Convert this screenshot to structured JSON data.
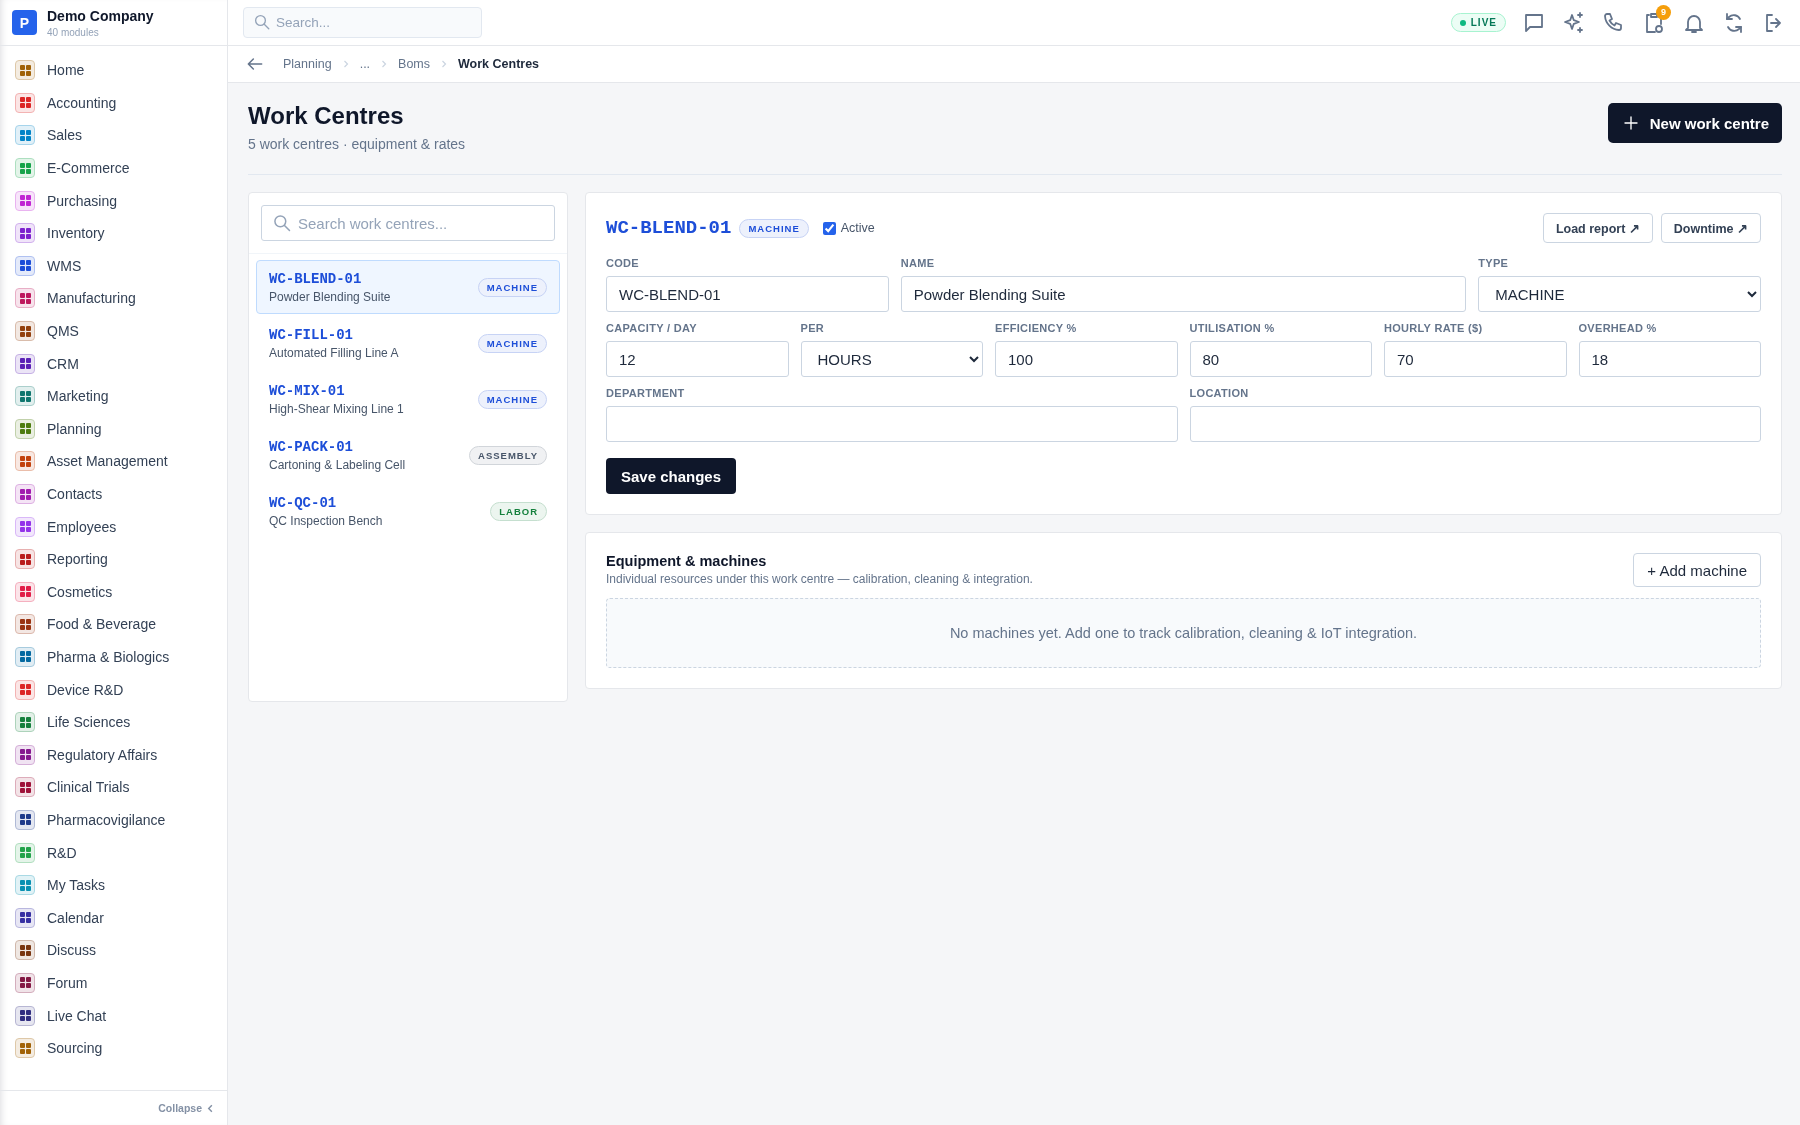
{
  "company": {
    "initial": "P",
    "name": "Demo Company",
    "subtitle": "40 modules"
  },
  "sidebar": {
    "items": [
      {
        "label": "Home",
        "color": "#a16207"
      },
      {
        "label": "Accounting",
        "color": "#dc2626"
      },
      {
        "label": "Sales",
        "color": "#0284c7"
      },
      {
        "label": "E-Commerce",
        "color": "#16a34a"
      },
      {
        "label": "Purchasing",
        "color": "#c026d3"
      },
      {
        "label": "Inventory",
        "color": "#7e22ce"
      },
      {
        "label": "WMS",
        "color": "#1d4ed8"
      },
      {
        "label": "Manufacturing",
        "color": "#be185d"
      },
      {
        "label": "QMS",
        "color": "#92400e"
      },
      {
        "label": "CRM",
        "color": "#5b21b6"
      },
      {
        "label": "Marketing",
        "color": "#0f766e"
      },
      {
        "label": "Planning",
        "color": "#4d7c0f"
      },
      {
        "label": "Asset Management",
        "color": "#c2410c"
      },
      {
        "label": "Contacts",
        "color": "#a21caf"
      },
      {
        "label": "Employees",
        "color": "#9333ea"
      },
      {
        "label": "Reporting",
        "color": "#b91c1c"
      },
      {
        "label": "Cosmetics",
        "color": "#e11d48"
      },
      {
        "label": "Food & Beverage",
        "color": "#9a3412"
      },
      {
        "label": "Pharma & Biologics",
        "color": "#0369a1"
      },
      {
        "label": "Device R&D",
        "color": "#dc2626"
      },
      {
        "label": "Life Sciences",
        "color": "#15803d"
      },
      {
        "label": "Regulatory Affairs",
        "color": "#86198f"
      },
      {
        "label": "Clinical Trials",
        "color": "#9f1239"
      },
      {
        "label": "Pharmacovigilance",
        "color": "#1e3a8a"
      },
      {
        "label": "R&D",
        "color": "#22a34a"
      },
      {
        "label": "My Tasks",
        "color": "#0891b2"
      },
      {
        "label": "Calendar",
        "color": "#3730a3"
      },
      {
        "label": "Discuss",
        "color": "#78350f"
      },
      {
        "label": "Forum",
        "color": "#831843"
      },
      {
        "label": "Live Chat",
        "color": "#312e81"
      },
      {
        "label": "Sourcing",
        "color": "#a16207"
      }
    ],
    "collapse": "Collapse"
  },
  "topbar": {
    "search_placeholder": "Search...",
    "live": "LIVE",
    "notification_count": "9"
  },
  "breadcrumbs": [
    {
      "label": "Planning",
      "current": false
    },
    {
      "label": "...",
      "current": false
    },
    {
      "label": "Boms",
      "current": false
    },
    {
      "label": "Work Centres",
      "current": true
    }
  ],
  "page": {
    "title": "Work Centres",
    "subtitle": "5 work centres · equipment & rates",
    "new_button": "New work centre"
  },
  "list": {
    "search_placeholder": "Search work centres...",
    "items": [
      {
        "code": "WC-BLEND-01",
        "name": "Powder Blending Suite",
        "type": "MACHINE",
        "color": "#1d4ed8",
        "selected": true
      },
      {
        "code": "WC-FILL-01",
        "name": "Automated Filling Line A",
        "type": "MACHINE",
        "color": "#1d4ed8",
        "selected": false
      },
      {
        "code": "WC-MIX-01",
        "name": "High-Shear Mixing Line 1",
        "type": "MACHINE",
        "color": "#1d4ed8",
        "selected": false
      },
      {
        "code": "WC-PACK-01",
        "name": "Cartoning & Labeling Cell",
        "type": "ASSEMBLY",
        "color": "#475569",
        "selected": false
      },
      {
        "code": "WC-QC-01",
        "name": "QC Inspection Bench",
        "type": "LABOR",
        "color": "#15803d",
        "selected": false
      }
    ]
  },
  "detail": {
    "code": "WC-BLEND-01",
    "type_badge": "MACHINE",
    "active": {
      "label": "Active",
      "checked": true
    },
    "actions": [
      "Load report ↗",
      "Downtime ↗"
    ],
    "rows": [
      {
        "fields": [
          {
            "label": "CODE",
            "kind": "input",
            "value": "WC-BLEND-01"
          },
          {
            "label": "NAME",
            "kind": "input",
            "value": "Powder Blending Suite"
          },
          {
            "label": "TYPE",
            "kind": "select",
            "value": "MACHINE"
          }
        ]
      },
      {
        "fields": [
          {
            "label": "CAPACITY / DAY",
            "kind": "input",
            "value": "12"
          },
          {
            "label": "PER",
            "kind": "select",
            "value": "HOURS"
          },
          {
            "label": "EFFICIENCY %",
            "kind": "input",
            "value": "100"
          },
          {
            "label": "UTILISATION %",
            "kind": "input",
            "value": "80"
          },
          {
            "label": "HOURLY RATE ($)",
            "kind": "input",
            "value": "70"
          },
          {
            "label": "OVERHEAD %",
            "kind": "input",
            "value": "18"
          }
        ]
      },
      {
        "fields": [
          {
            "label": "DEPARTMENT",
            "kind": "input"
          },
          {
            "label": "LOCATION",
            "kind": "input"
          }
        ]
      }
    ],
    "save": "Save changes"
  },
  "equipment": {
    "title": "Equipment & machines",
    "description": "Individual resources under this work centre — calibration, cleaning & integration.",
    "add_button": "+ Add machine",
    "empty": "No machines yet. Add one to track calibration, cleaning & IoT integration."
  }
}
